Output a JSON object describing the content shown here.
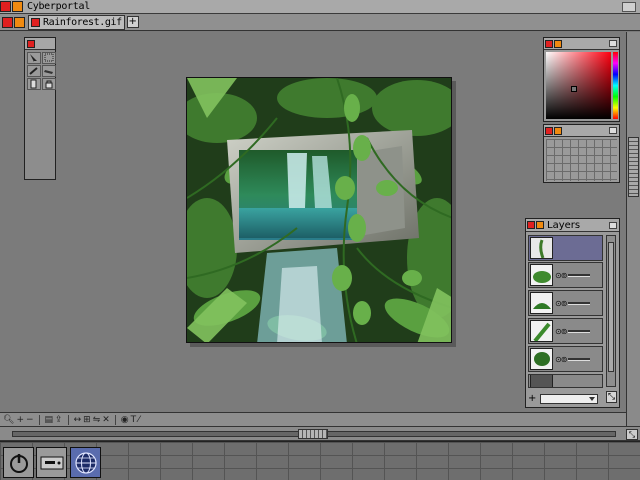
{
  "app": {
    "window_title": "Cyberportal"
  },
  "tabs": [
    {
      "label": "Rainforest.gif",
      "active": true
    }
  ],
  "tab_add_label": "+",
  "tool_palette": {
    "tools": [
      "arrow-select-icon",
      "marquee-icon",
      "pencil-icon",
      "eraser-icon",
      "gradient-icon",
      "lock-icon"
    ]
  },
  "colors": {
    "accent_red": "#e02020",
    "accent_orange": "#f08a10",
    "workspace": "#7b7b7b",
    "selected_layer": "#6c6c94",
    "taskbar_active": "#5a6cae"
  },
  "layers_panel": {
    "title": "Layers",
    "layer_count": 6,
    "selected_index": 0
  },
  "status_icons": [
    "zoom-icon",
    "zoom-in-icon",
    "zoom-out-icon",
    "grid-icon",
    "export-icon",
    "arrows-icon",
    "transform-icon",
    "text-icon",
    "wand-icon"
  ],
  "taskbar": {
    "items": [
      "power-icon",
      "drive-icon",
      "globe-icon"
    ],
    "active_index": 2
  }
}
